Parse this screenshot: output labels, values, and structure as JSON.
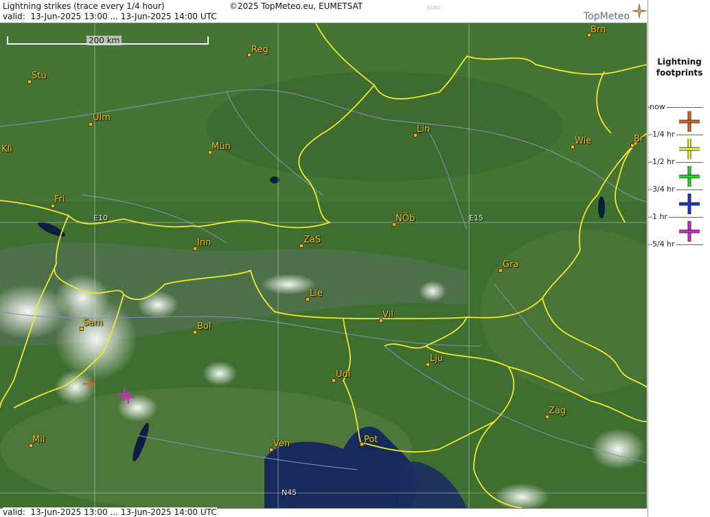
{
  "header": {
    "title": "Lightning strikes (trace every 1/4 hour)",
    "copyright": "©2025 TopMeteo.eu, EUMETSAT",
    "code": "3040",
    "valid": "valid:  13-Jun-2025 13:00 ... 13-Jun-2025 14:00 UTC"
  },
  "footer": {
    "valid": "valid:  13-Jun-2025 13:00 ... 13-Jun-2025 14:00 UTC"
  },
  "logo": {
    "text": "TopMeteo"
  },
  "scale": {
    "label": "200 km"
  },
  "grid_labels": [
    "E10",
    "E15",
    "N45"
  ],
  "cities": [
    "Brn",
    "Reg",
    "Stu",
    "Ulm",
    "Kli",
    "Mün",
    "Lin",
    "Wie",
    "Br",
    "Fri",
    "NÖb",
    "Inn",
    "ZaS",
    "Gra",
    "Lie",
    "Vil",
    "Sam",
    "Bol",
    "Lju",
    "Udi",
    "Zag",
    "Mil",
    "Ven",
    "Pot"
  ],
  "legend": {
    "title_line1": "Lightning",
    "title_line2": "footprints",
    "entries": [
      {
        "label": "now",
        "color": ""
      },
      {
        "label": "-1/4 hr",
        "color": "#e8601c"
      },
      {
        "label": "-1/2 hr",
        "color": "#ffff30"
      },
      {
        "label": "-3/4 hr",
        "color": "#22e022"
      },
      {
        "label": "-1 hr",
        "color": "#1830d8"
      },
      {
        "label": "-5/4 hr",
        "color": "#e020d8"
      }
    ]
  },
  "strikes": [
    {
      "age": "-1/4 hr",
      "color": "#e8601c"
    },
    {
      "age": "-5/4 hr",
      "color": "#e020d8"
    },
    {
      "age": "-5/4 hr",
      "color": "#e020d8"
    }
  ]
}
